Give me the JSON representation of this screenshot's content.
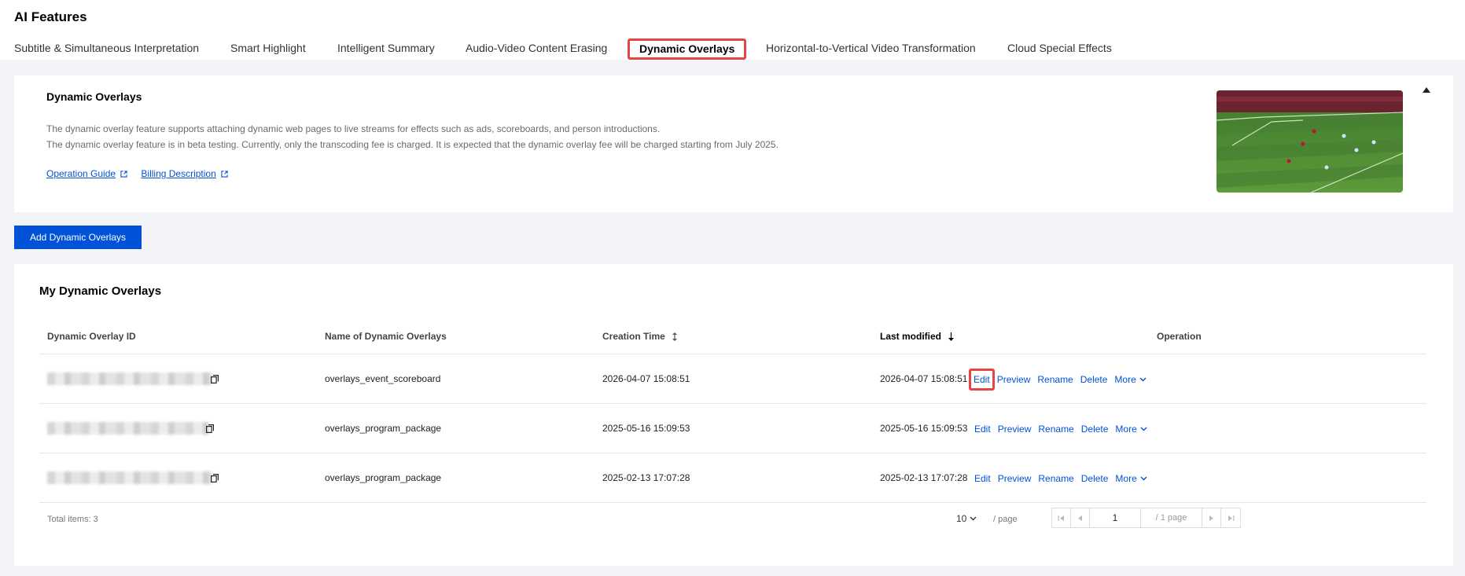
{
  "header": {
    "title": "AI Features",
    "tabs": [
      {
        "label": "Subtitle & Simultaneous Interpretation"
      },
      {
        "label": "Smart Highlight"
      },
      {
        "label": "Intelligent Summary"
      },
      {
        "label": "Audio-Video Content Erasing"
      },
      {
        "label": "Dynamic Overlays",
        "active": true
      },
      {
        "label": "Horizontal-to-Vertical Video Transformation"
      },
      {
        "label": "Cloud Special Effects"
      }
    ]
  },
  "intro": {
    "title": "Dynamic Overlays",
    "line1": "The dynamic overlay feature supports attaching dynamic web pages to live streams for effects such as ads, scoreboards, and person introductions.",
    "line2": "The dynamic overlay feature is in beta testing. Currently, only the transcoding fee is charged. It is expected that the dynamic overlay fee will be charged starting from July 2025.",
    "links": {
      "guide": "Operation Guide",
      "billing": "Billing Description"
    }
  },
  "actions": {
    "add_label": "Add Dynamic Overlays"
  },
  "table": {
    "title": "My Dynamic Overlays",
    "columns": {
      "id": "Dynamic Overlay ID",
      "name": "Name of Dynamic Overlays",
      "created": "Creation Time",
      "modified": "Last modified",
      "operation": "Operation"
    },
    "operations": {
      "edit": "Edit",
      "preview": "Preview",
      "rename": "Rename",
      "delete": "Delete",
      "more": "More"
    },
    "rows": [
      {
        "name": "overlays_event_scoreboard",
        "created": "2026-04-07 15:08:51",
        "modified": "2026-04-07 15:08:51"
      },
      {
        "name": "overlays_program_package",
        "created": "2025-05-16 15:09:53",
        "modified": "2025-05-16 15:09:53"
      },
      {
        "name": "overlays_program_package",
        "created": "2025-02-13 17:07:28",
        "modified": "2025-02-13 17:07:28"
      }
    ]
  },
  "pagination": {
    "total": "Total items: 3",
    "page_size": "10",
    "per_page": "/ page",
    "current_page": "1",
    "page_total": "/ 1 page"
  },
  "colors": {
    "accent": "#0052d9",
    "highlight": "#e54545",
    "background": "#f2f4f8"
  }
}
